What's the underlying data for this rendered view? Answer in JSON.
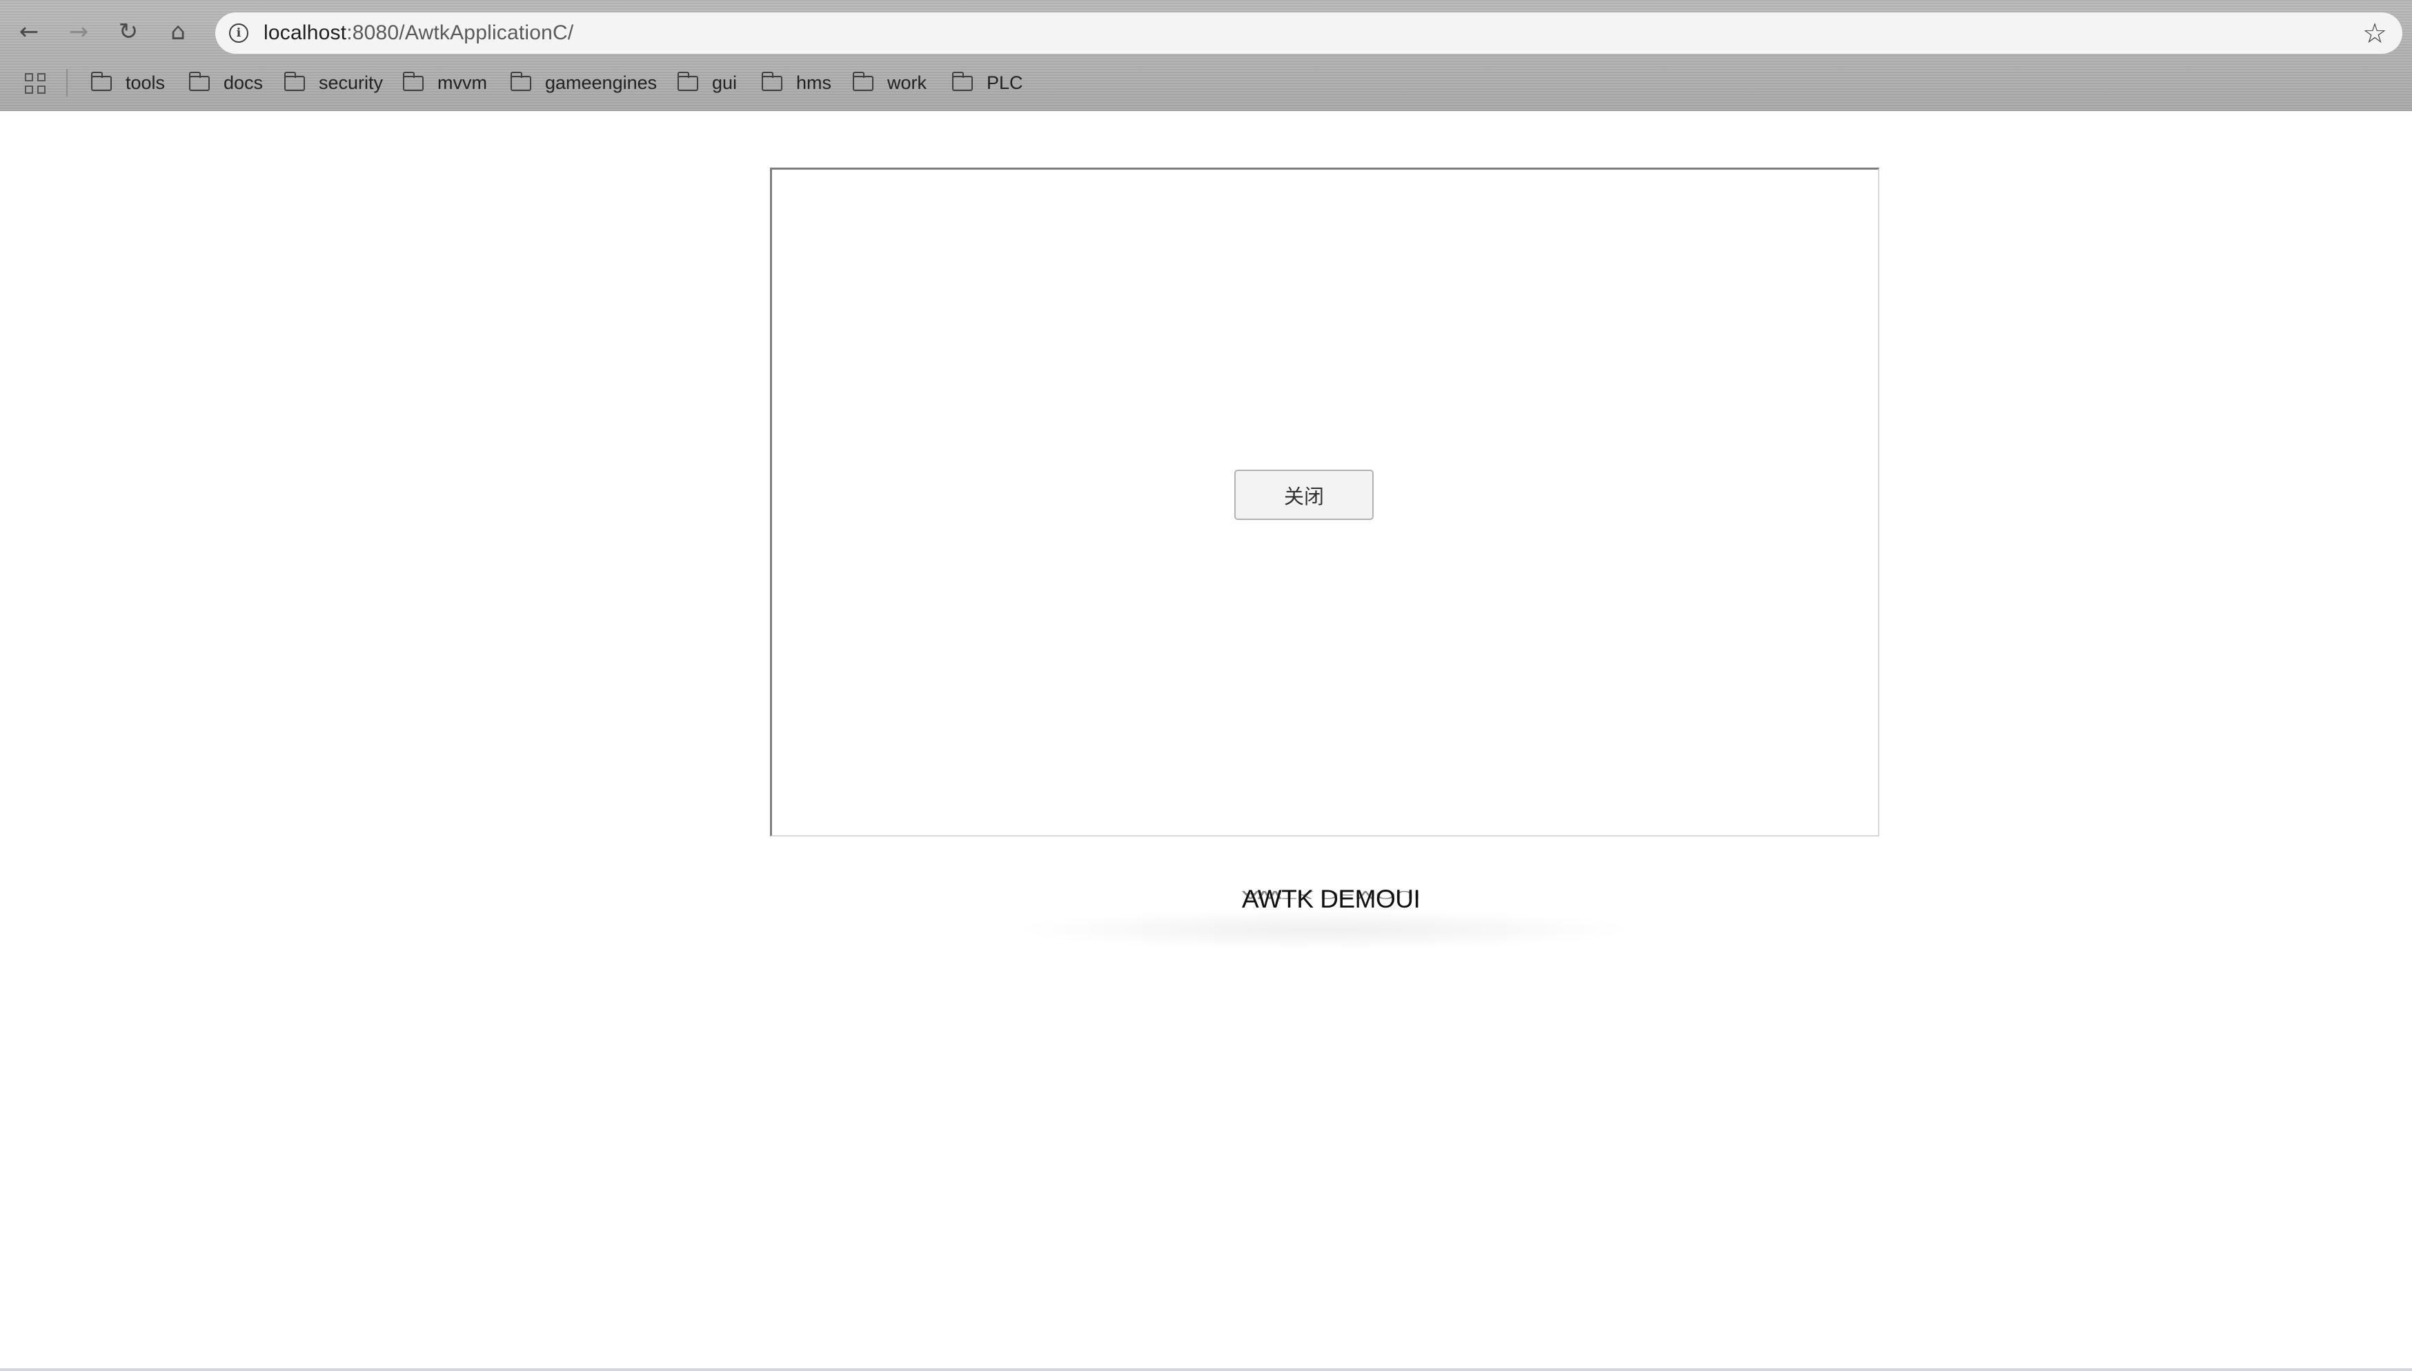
{
  "browser": {
    "url_host": "localhost",
    "url_rest": ":8080/AwtkApplicationC/",
    "nav": {
      "back_icon": "←",
      "forward_icon": "→",
      "reload_icon": "↻",
      "home_icon": "⌂"
    },
    "info_icon": "i",
    "star_icon": "☆"
  },
  "bookmarks": [
    {
      "label": "tools"
    },
    {
      "label": "docs"
    },
    {
      "label": "security"
    },
    {
      "label": "mvvm"
    },
    {
      "label": "gameengines"
    },
    {
      "label": "gui"
    },
    {
      "label": "hms"
    },
    {
      "label": "work"
    },
    {
      "label": "PLC"
    }
  ],
  "app": {
    "close_button_label": "关闭",
    "demo_title": "AWTK DEMOUI"
  },
  "icons": {
    "back": "back-arrow-icon",
    "forward": "forward-arrow-icon",
    "reload": "reload-icon",
    "home": "home-icon",
    "info": "info-icon",
    "star": "star-icon",
    "apps": "apps-grid-icon",
    "folder": "folder-icon"
  }
}
